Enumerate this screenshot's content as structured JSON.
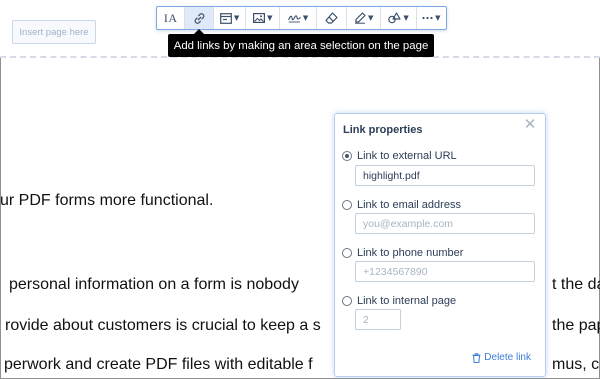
{
  "toolbar": {
    "items": [
      {
        "name": "text-recognition",
        "label": "IA"
      },
      {
        "name": "link",
        "icon": "link-icon"
      },
      {
        "name": "form-field",
        "icon": "form-field-icon"
      },
      {
        "name": "image",
        "icon": "image-icon"
      },
      {
        "name": "signature",
        "icon": "signature-icon"
      },
      {
        "name": "eraser",
        "icon": "eraser-icon"
      },
      {
        "name": "highlight",
        "icon": "pen-icon"
      },
      {
        "name": "shapes",
        "icon": "shapes-icon"
      },
      {
        "name": "more",
        "icon": "more-icon"
      }
    ],
    "active": "link"
  },
  "tooltip": {
    "text": "Add links by making an area selection on the page"
  },
  "insert_page": {
    "label": "Insert page here"
  },
  "document": {
    "line1": "ur PDF forms more functional.",
    "line2": "personal information on a form is nobody",
    "line2_right": "t the da",
    "line3": "rovide about customers is crucial to keep a s",
    "line3_right": "the pape",
    "line4": "perwork and create PDF files with editable f",
    "line4_right": "mus, che"
  },
  "link_panel": {
    "title": "Link properties",
    "options": [
      {
        "label": "Link to external URL",
        "selected": true,
        "value": "highlight.pdf",
        "placeholder": ""
      },
      {
        "label": "Link to email address",
        "selected": false,
        "value": "",
        "placeholder": "you@example.com"
      },
      {
        "label": "Link to phone number",
        "selected": false,
        "value": "",
        "placeholder": "+1234567890"
      },
      {
        "label": "Link to internal page",
        "selected": false,
        "value": "",
        "placeholder": "2"
      }
    ],
    "delete_label": "Delete link"
  },
  "colors": {
    "accent": "#3d7bd6",
    "toolbar_border": "#7fa9e0",
    "tooltip_bg": "#000000"
  }
}
